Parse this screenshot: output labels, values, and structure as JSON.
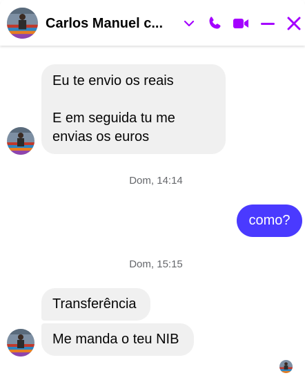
{
  "header": {
    "contact_name": "Carlos Manuel c...",
    "icons": [
      "chevron-down-icon",
      "phone-icon",
      "video-icon",
      "minimize-icon",
      "close-icon"
    ],
    "accent_color": "#a400ff"
  },
  "messages": [
    {
      "direction": "in",
      "text_line1": "Eu te envio os reais",
      "text_line2": "E em seguida tu me",
      "text_line3": "envias os euros"
    },
    {
      "type": "timestamp",
      "text": "Dom, 14:14"
    },
    {
      "direction": "out",
      "text": "como?"
    },
    {
      "type": "timestamp",
      "text": "Dom, 15:15"
    },
    {
      "direction": "in",
      "text": "Transferência"
    },
    {
      "direction": "in",
      "text": "Me manda o teu NIB"
    }
  ],
  "colors": {
    "outgoing_bubble": "#4a3aff",
    "incoming_bubble": "#f0f0f0"
  }
}
